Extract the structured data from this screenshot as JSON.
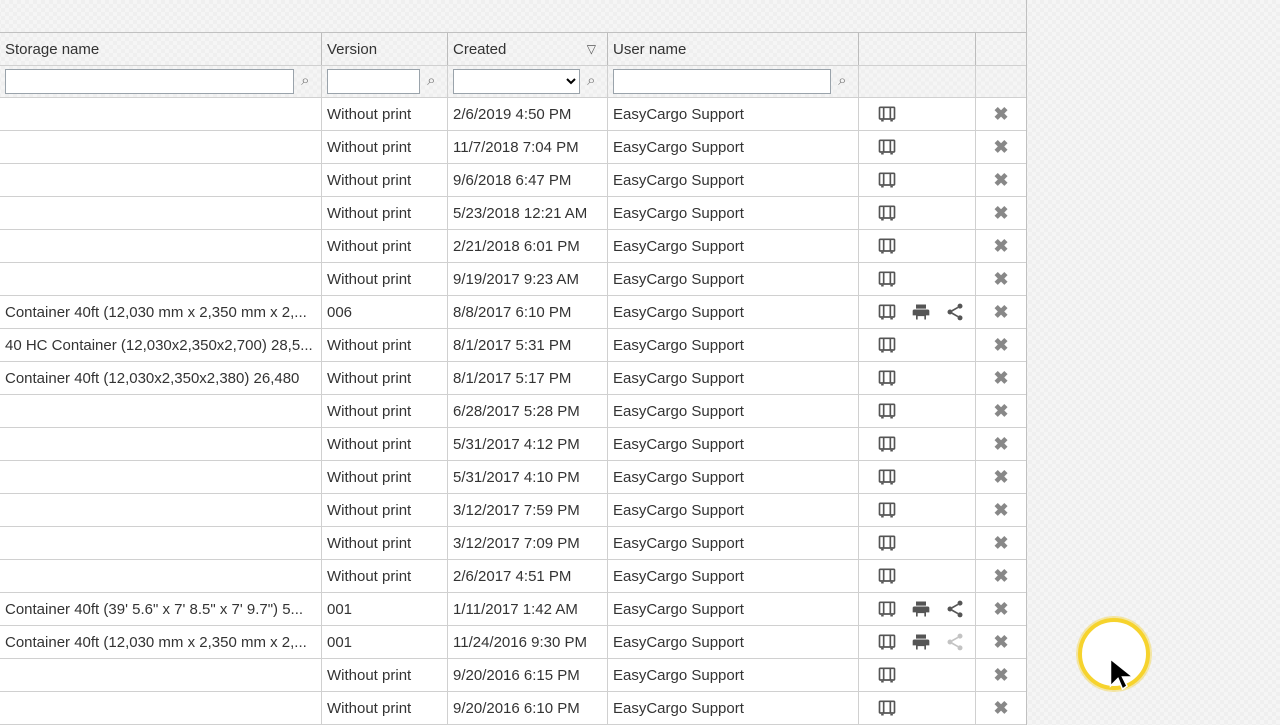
{
  "headers": {
    "storage": "Storage name",
    "version": "Version",
    "created": "Created",
    "user": "User name"
  },
  "filters": {
    "storage": "",
    "version": "",
    "created": "",
    "user": ""
  },
  "rows": [
    {
      "storage": "",
      "version": "Without print",
      "created": "2/6/2019 4:50 PM",
      "user": "EasyCargo Support",
      "print": false,
      "share": false,
      "del": true
    },
    {
      "storage": "",
      "version": "Without print",
      "created": "11/7/2018 7:04 PM",
      "user": "EasyCargo Support",
      "print": false,
      "share": false,
      "del": true
    },
    {
      "storage": "",
      "version": "Without print",
      "created": "9/6/2018 6:47 PM",
      "user": "EasyCargo Support",
      "print": false,
      "share": false,
      "del": true
    },
    {
      "storage": "",
      "version": "Without print",
      "created": "5/23/2018 12:21 AM",
      "user": "EasyCargo Support",
      "print": false,
      "share": false,
      "del": true
    },
    {
      "storage": "",
      "version": "Without print",
      "created": "2/21/2018 6:01 PM",
      "user": "EasyCargo Support",
      "print": false,
      "share": false,
      "del": true
    },
    {
      "storage": "",
      "version": "Without print",
      "created": "9/19/2017 9:23 AM",
      "user": "EasyCargo Support",
      "print": false,
      "share": false,
      "del": true
    },
    {
      "storage": "Container 40ft (12,030 mm x 2,350 mm x 2,...",
      "version": "006",
      "created": "8/8/2017 6:10 PM",
      "user": "EasyCargo Support",
      "print": true,
      "share": true,
      "del": true
    },
    {
      "storage": "40 HC Container (12,030x2,350x2,700) 28,5...",
      "version": "Without print",
      "created": "8/1/2017 5:31 PM",
      "user": "EasyCargo Support",
      "print": false,
      "share": false,
      "del": true
    },
    {
      "storage": "Container 40ft (12,030x2,350x2,380) 26,480",
      "version": "Without print",
      "created": "8/1/2017 5:17 PM",
      "user": "EasyCargo Support",
      "print": false,
      "share": false,
      "del": true
    },
    {
      "storage": "",
      "version": "Without print",
      "created": "6/28/2017 5:28 PM",
      "user": "EasyCargo Support",
      "print": false,
      "share": false,
      "del": true
    },
    {
      "storage": "",
      "version": "Without print",
      "created": "5/31/2017 4:12 PM",
      "user": "EasyCargo Support",
      "print": false,
      "share": false,
      "del": true
    },
    {
      "storage": "",
      "version": "Without print",
      "created": "5/31/2017 4:10 PM",
      "user": "EasyCargo Support",
      "print": false,
      "share": false,
      "del": true
    },
    {
      "storage": "",
      "version": "Without print",
      "created": "3/12/2017 7:59 PM",
      "user": "EasyCargo Support",
      "print": false,
      "share": false,
      "del": true
    },
    {
      "storage": "",
      "version": "Without print",
      "created": "3/12/2017 7:09 PM",
      "user": "EasyCargo Support",
      "print": false,
      "share": false,
      "del": true
    },
    {
      "storage": "",
      "version": "Without print",
      "created": "2/6/2017 4:51 PM",
      "user": "EasyCargo Support",
      "print": false,
      "share": false,
      "del": true
    },
    {
      "storage": "Container 40ft (39' 5.6\" x 7' 8.5\" x 7' 9.7\") 5...",
      "version": "001",
      "created": "1/11/2017 1:42 AM",
      "user": "EasyCargo Support",
      "print": true,
      "share": true,
      "del": true
    },
    {
      "storage": "Container 40ft (12,030 mm x 2,350 mm x 2,...",
      "version": "001",
      "created": "11/24/2016 9:30 PM",
      "user": "EasyCargo Support",
      "print": true,
      "share": true,
      "share_faded": true,
      "del": true
    },
    {
      "storage": "",
      "version": "Without print",
      "created": "9/20/2016 6:15 PM",
      "user": "EasyCargo Support",
      "print": false,
      "share": false,
      "del": true
    },
    {
      "storage": "",
      "version": "Without print",
      "created": "9/20/2016 6:10 PM",
      "user": "EasyCargo Support",
      "print": false,
      "share": false,
      "del": true
    }
  ]
}
